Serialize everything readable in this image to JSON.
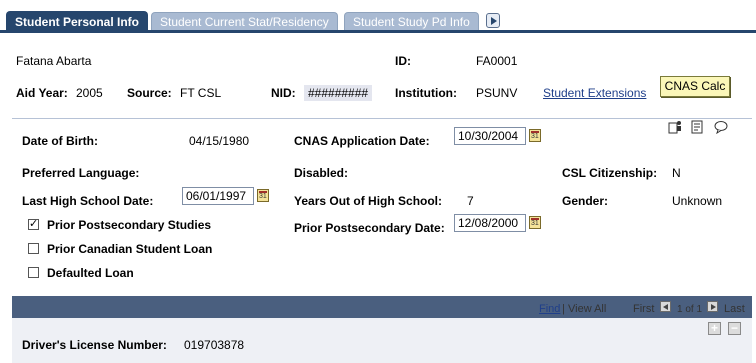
{
  "tabs": [
    {
      "label": "Student Personal Info"
    },
    {
      "label": "Student Current Stat/Residency"
    },
    {
      "label": "Student Study Pd Info"
    }
  ],
  "student": {
    "name": "Fatana Abarta",
    "id_label": "ID:",
    "id_value": "FA0001",
    "aid_year_label": "Aid Year:",
    "aid_year_value": "2005",
    "source_label": "Source:",
    "source_value": "FT CSL",
    "nid_label": "NID:",
    "nid_value": "#########",
    "institution_label": "Institution:",
    "institution_value": "PSUNV",
    "extensions_link": "Student Extensions",
    "cnas_calc_button": "CNAS Calc"
  },
  "personal": {
    "dob_label": "Date of Birth:",
    "dob_value": "04/15/1980",
    "cnas_app_date_label": "CNAS Application Date:",
    "cnas_app_date_value": "10/30/2004",
    "pref_lang_label": "Preferred Language:",
    "disabled_label": "Disabled:",
    "csl_citizenship_label": "CSL Citizenship:",
    "csl_citizenship_value": "N",
    "last_hs_date_label": "Last High School Date:",
    "last_hs_date_value": "06/01/1997",
    "years_out_label": "Years Out of High School:",
    "years_out_value": "7",
    "gender_label": "Gender:",
    "gender_value": "Unknown",
    "prior_postsec_studies_label": "Prior Postsecondary Studies",
    "prior_postsec_studies_checked": true,
    "prior_postsec_date_label": "Prior Postsecondary Date:",
    "prior_postsec_date_value": "12/08/2000",
    "prior_csl_label": "Prior Canadian Student Loan",
    "prior_csl_checked": false,
    "defaulted_loan_label": "Defaulted Loan",
    "defaulted_loan_checked": false
  },
  "grid": {
    "find_link": "Find",
    "sep": "|",
    "view_all_link": "View All",
    "first_label": "First",
    "range_label": "1 of 1",
    "last_label": "Last",
    "add_symbol": "+",
    "remove_symbol": "−",
    "drivers_license_label": "Driver's License Number:",
    "drivers_license_value": "019703878"
  },
  "colors": {
    "active_tab": "#26466d",
    "inactive_tab": "#a9bad2",
    "grid_bar": "#4a5f7f",
    "link": "#1f3f8a",
    "button_bg": "#fbf7b8"
  }
}
